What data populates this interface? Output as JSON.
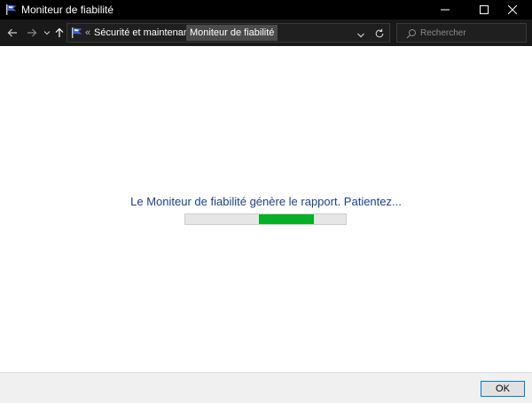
{
  "window": {
    "title": "Moniteur de fiabilité",
    "icon": "flag-icon"
  },
  "navigation": {
    "breadcrumbs": [
      {
        "label": "Sécurité et maintenance"
      },
      {
        "label": "Moniteur de fiabilité"
      }
    ],
    "search_placeholder": "Rechercher"
  },
  "content": {
    "status_message": "Le Moniteur de fiabilité génère le rapport. Patientez...",
    "progress": {
      "fill_start_fraction": 0.46,
      "fill_end_fraction": 0.8
    }
  },
  "footer": {
    "ok_label": "OK"
  },
  "colors": {
    "status_text": "#1e3f8c",
    "progress_fill": "#06b025",
    "titlebar": "#000000",
    "focus_border": "#0078d7"
  }
}
